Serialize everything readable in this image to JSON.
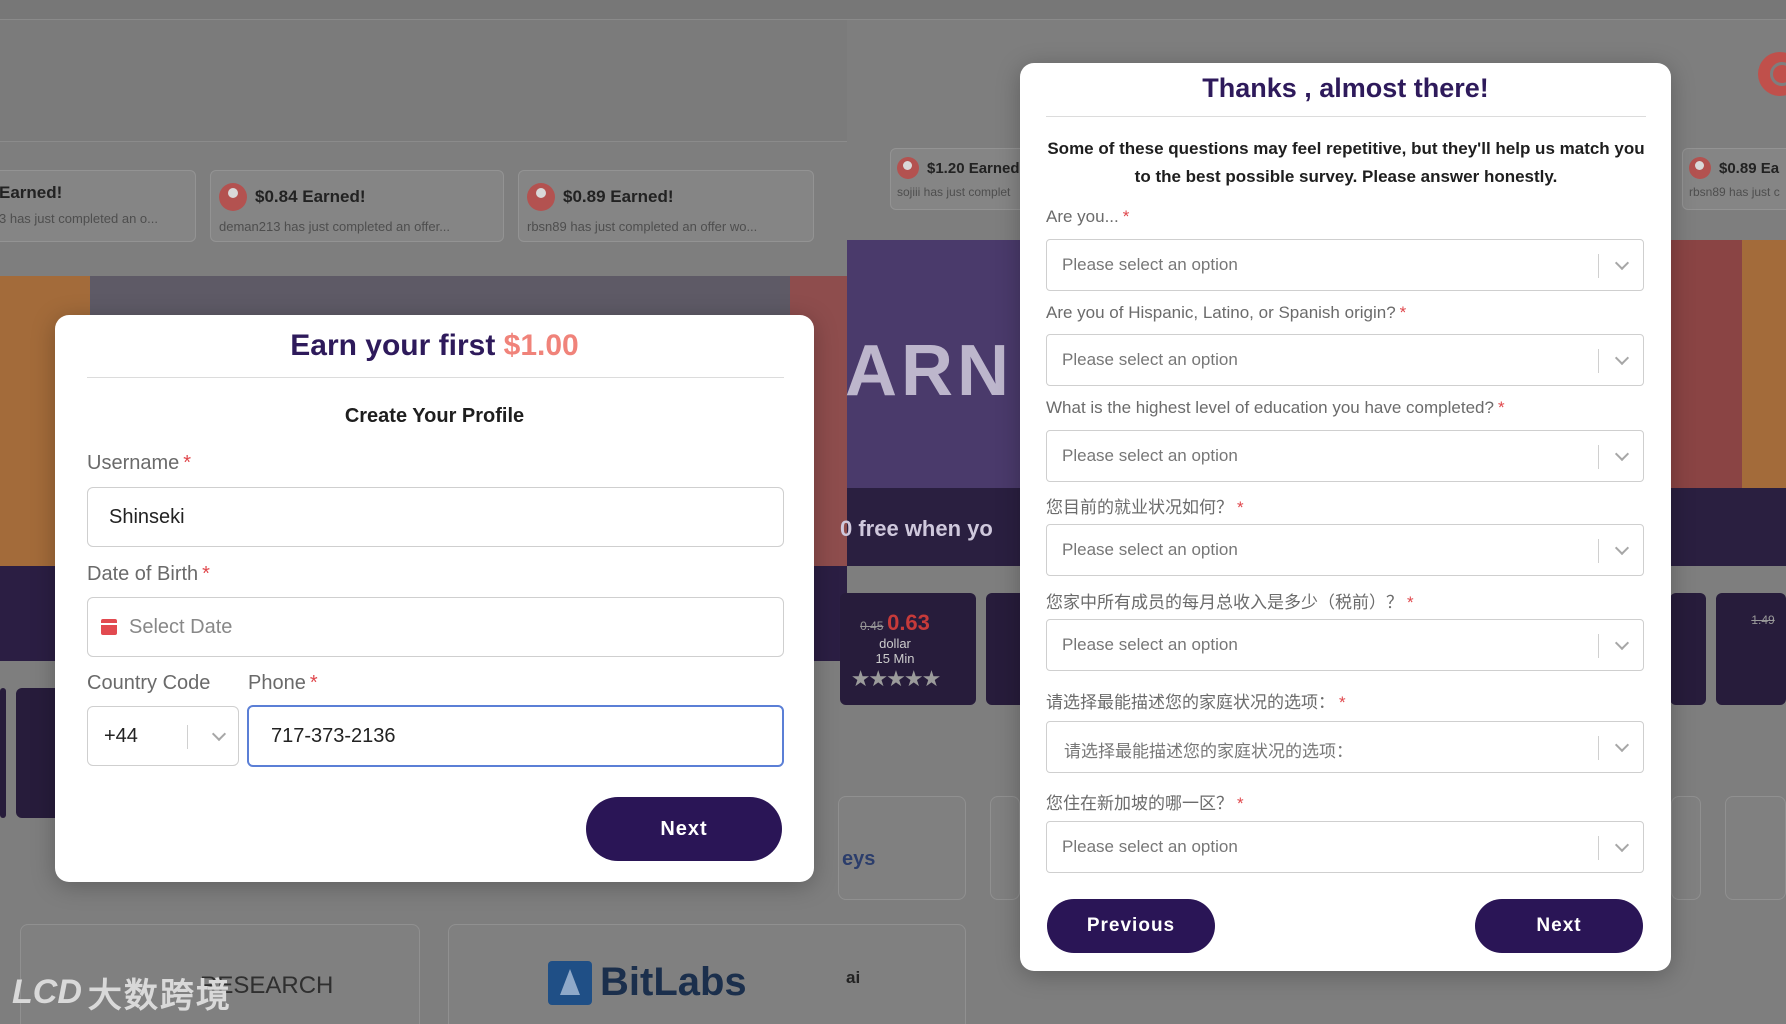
{
  "background": {
    "tickers": [
      {
        "amount": "Earned!",
        "sub": "3 has just completed an o..."
      },
      {
        "amount": "$0.84 Earned!",
        "sub": "deman213 has just completed an offer..."
      },
      {
        "amount": "$0.89 Earned!",
        "sub": "rbsn89 has just completed an offer wo..."
      },
      {
        "amount": "$1.20 Earned",
        "sub": "sojiii has just complet"
      },
      {
        "amount": "$0.89 Ea",
        "sub": "rbsn89 has just c"
      }
    ],
    "banner_big_text": "ARN",
    "banner_free_text": "0 free when yo",
    "offer": {
      "old_price": "0.45",
      "new_price": "0.63",
      "unit": "dollar",
      "time": "15 Min",
      "stars": "★★★★★",
      "right_old": "1.49"
    },
    "tiles": {
      "research": "RESEARCH",
      "eys": "eys",
      "bitlabs": "BitLabs",
      "ai": "ai"
    },
    "watermark": {
      "logo": "LCD",
      "text": "大数跨境"
    },
    "accent_color": "#2a1556"
  },
  "left_modal": {
    "title_prefix": "Earn your first ",
    "title_amount": "$1.00",
    "subtitle": "Create Your Profile",
    "username": {
      "label": "Username",
      "required": "*",
      "value": "Shinseki"
    },
    "dob": {
      "label": "Date of Birth",
      "required": "*",
      "placeholder": "Select Date",
      "icon": "calendar-icon"
    },
    "country_code": {
      "label": "Country Code",
      "value": "+44"
    },
    "phone": {
      "label": "Phone",
      "required": "*",
      "value": "717-373-2136"
    },
    "next_label": "Next"
  },
  "right_modal": {
    "title": "Thanks , almost there!",
    "intro_line1": "Some of these questions may feel repetitive, but they'll help us match you",
    "intro_line2": "to the best possible survey. Please answer honestly.",
    "questions": [
      {
        "label": "Are you...",
        "required": "*",
        "placeholder": "Please select an option"
      },
      {
        "label": "Are you of Hispanic, Latino, or Spanish origin?",
        "required": "*",
        "placeholder": "Please select an option"
      },
      {
        "label": "What is the highest level of education you have completed?",
        "required": "*",
        "placeholder": "Please select an option"
      },
      {
        "label": "您目前的就业状况如何？",
        "required": "*",
        "placeholder": "Please select an option"
      },
      {
        "label": "您家中所有成员的每月总收入是多少（税前）？",
        "required": "*",
        "placeholder": "Please select an option"
      },
      {
        "label": "请选择最能描述您的家庭状况的选项：",
        "required": "*",
        "placeholder": "请选择最能描述您的家庭状况的选项："
      },
      {
        "label": "您住在新加坡的哪一区？",
        "required": "*",
        "placeholder": "Please select an option"
      }
    ],
    "previous_label": "Previous",
    "next_label": "Next"
  }
}
